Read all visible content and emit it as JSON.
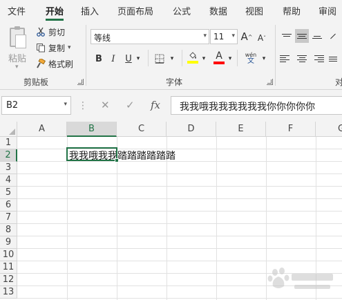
{
  "tabs": [
    "文件",
    "开始",
    "插入",
    "页面布局",
    "公式",
    "数据",
    "视图",
    "帮助",
    "审阅"
  ],
  "active_tab": "开始",
  "clipboard": {
    "paste_label": "粘贴",
    "cut_label": "剪切",
    "copy_label": "复制",
    "format_painter_label": "格式刷",
    "group_label": "剪贴板"
  },
  "font": {
    "name": "等线",
    "size": "11",
    "grow_label": "A",
    "shrink_label": "A",
    "bold_label": "B",
    "italic_label": "I",
    "underline_label": "U",
    "phonetic_top": "wén",
    "phonetic_bottom": "文",
    "font_color_label": "A",
    "group_label": "字体",
    "highlight_color": "#ffff00",
    "font_color": "#ff0000"
  },
  "alignment": {
    "group_label_partial": "对"
  },
  "formula_bar": {
    "name_box": "B2",
    "cancel_icon": "✕",
    "enter_icon": "✓",
    "fx_label": "fx",
    "content": "我我哦我我我我我我你你你你你"
  },
  "columns": [
    "A",
    "B",
    "C",
    "D",
    "E",
    "F",
    "G"
  ],
  "rows": [
    "1",
    "2",
    "3",
    "4",
    "5",
    "6",
    "7",
    "8",
    "9",
    "10",
    "11",
    "12",
    "13"
  ],
  "selected_column": "B",
  "selected_row": "2",
  "cell_b2_display": "我我哦我我踏踏踏踏踏踏",
  "colors": {
    "accent": "#217346",
    "ribbon_bg": "#f3f3f3"
  }
}
